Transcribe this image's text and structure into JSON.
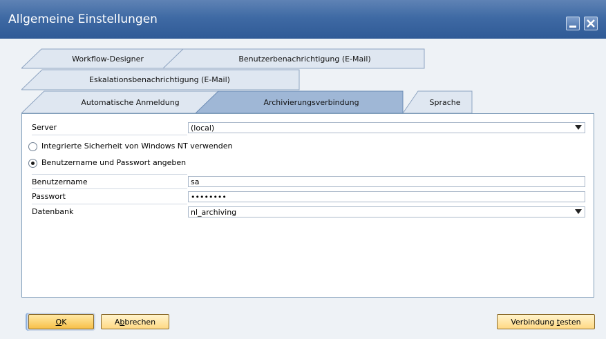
{
  "window": {
    "title": "Allgemeine Einstellungen",
    "accent": "#3f6aa4"
  },
  "tabs": {
    "row1": [
      {
        "label": "Workflow-Designer"
      },
      {
        "label": "Benutzerbenachrichtigung (E-Mail)"
      }
    ],
    "row2": [
      {
        "label": "Eskalationsbenachrichtigung (E-Mail)"
      }
    ],
    "row3": [
      {
        "label": "Automatische Anmeldung"
      },
      {
        "label": "Archivierungsverbindung",
        "active": true
      },
      {
        "label": "Sprache"
      }
    ]
  },
  "form": {
    "server": {
      "label": "Server",
      "value": "(local)"
    },
    "auth_options": [
      {
        "label": "Integrierte Sicherheit von Windows NT verwenden",
        "selected": false
      },
      {
        "label": "Benutzername und Passwort angeben",
        "selected": true
      }
    ],
    "username": {
      "label": "Benutzername",
      "value": "sa"
    },
    "password": {
      "label": "Passwort",
      "value": "••••••••"
    },
    "database": {
      "label": "Datenbank",
      "value": "nl_archiving"
    }
  },
  "buttons": {
    "ok": {
      "pre": "",
      "ul": "O",
      "post": "K"
    },
    "cancel": {
      "pre": "A",
      "ul": "b",
      "post": "brechen"
    },
    "test": {
      "pre": "Verbindung ",
      "ul": "t",
      "post": "esten"
    }
  }
}
